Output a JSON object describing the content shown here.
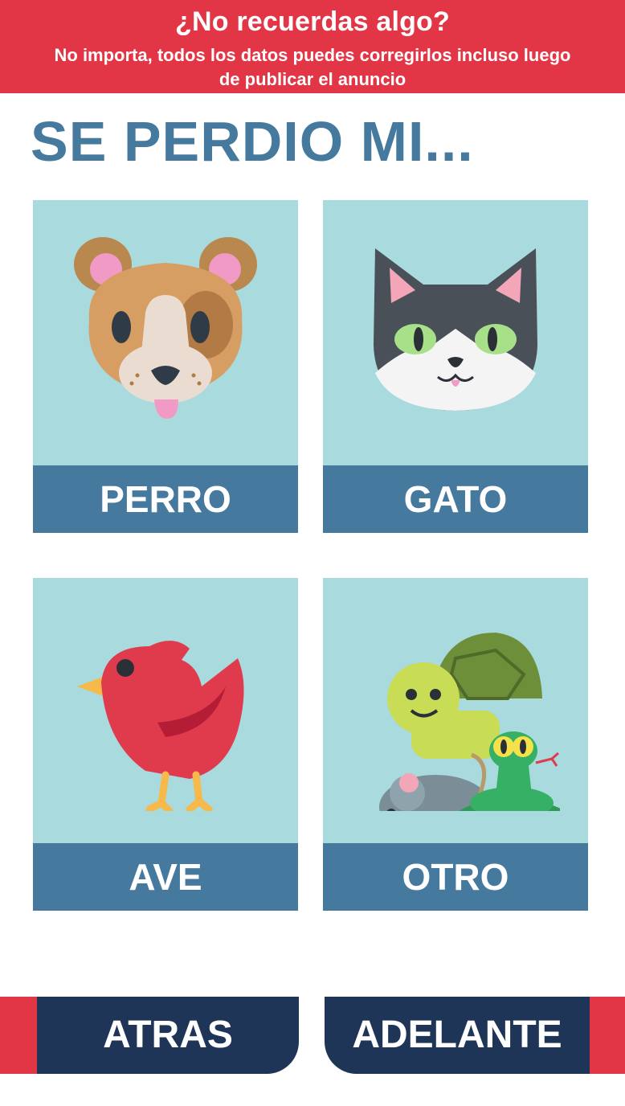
{
  "banner": {
    "title": "¿No recuerdas algo?",
    "subtitle": "No importa, todos los datos puedes corregirlos incluso luego de publicar el anuncio"
  },
  "page": {
    "title": "SE PERDIO MI..."
  },
  "options": {
    "perro": {
      "label": "PERRO",
      "icon": "dog-icon"
    },
    "gato": {
      "label": "GATO",
      "icon": "cat-icon"
    },
    "ave": {
      "label": "AVE",
      "icon": "bird-icon"
    },
    "otro": {
      "label": "OTRO",
      "icon": "other-animals-icon"
    }
  },
  "nav": {
    "back_label": "ATRAS",
    "next_label": "ADELANTE"
  },
  "colors": {
    "accent_red": "#e23545",
    "primary_blue": "#45799e",
    "card_bg": "#a8dade",
    "nav_dark": "#1e3557"
  }
}
